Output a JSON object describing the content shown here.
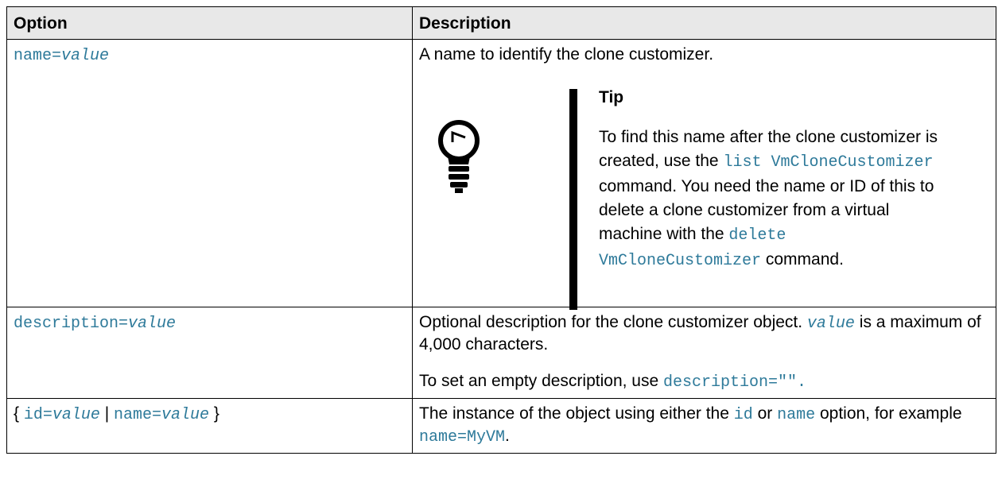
{
  "table": {
    "headers": {
      "option": "Option",
      "description": "Description"
    },
    "row1": {
      "opt_name": "name=",
      "opt_value": "value",
      "desc": "A name to identify the clone customizer.",
      "tip": {
        "title": "Tip",
        "text1": "To find this name after the clone customizer is created, use the ",
        "code1": "list VmCloneCustomizer",
        "text2": " command. You need the name or ID of this to delete a clone customizer from a virtual machine with the ",
        "code2": "delete VmCloneCustomizer",
        "text3": " command."
      }
    },
    "row2": {
      "opt_name": "description=",
      "opt_value": "value",
      "desc_code": "value",
      "desc1": " is a maximum of 4,000 characters.",
      "desc_prefix": "Optional description for the clone customizer object. ",
      "desc2_text": "To set an empty description, use ",
      "desc2_code": "description=\"\"."
    },
    "row3": {
      "brace_open": "{ ",
      "opt_id": "id=",
      "opt_value1": "value",
      "pipe": " | ",
      "opt_name": "name=",
      "opt_value2": "value",
      "brace_close": " }",
      "desc1": "The instance of the object using either the ",
      "code_id": "id",
      "desc_or": " or ",
      "code_name": "name",
      "desc2": " option, for example ",
      "code_example": "name=MyVM",
      "desc_end": "."
    }
  },
  "icons": {
    "tip": "lightbulb-icon"
  }
}
